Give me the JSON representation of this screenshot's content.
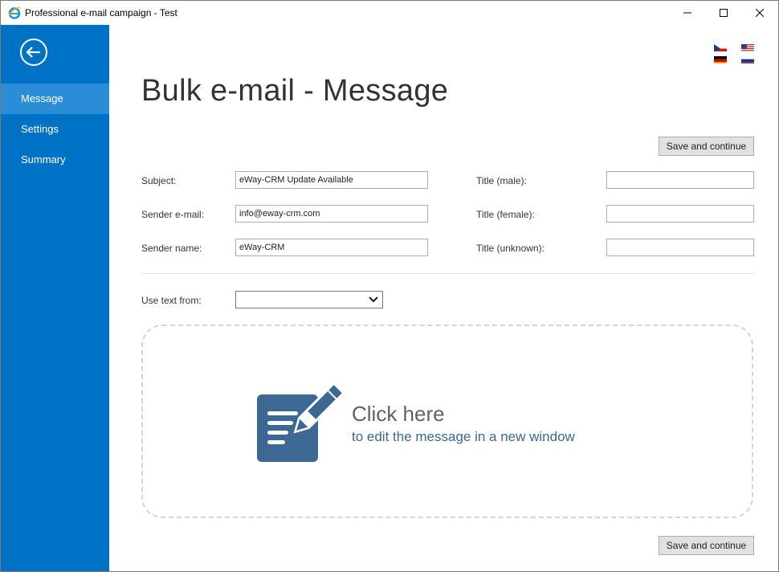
{
  "window": {
    "title": "Professional e-mail campaign - Test",
    "icons": [
      "app-icon",
      "minimize-icon",
      "maximize-icon",
      "close-icon"
    ]
  },
  "sidebar": {
    "back_icon": "back-arrow-icon",
    "items": [
      {
        "label": "Message",
        "active": true
      },
      {
        "label": "Settings",
        "active": false
      },
      {
        "label": "Summary",
        "active": false
      }
    ],
    "color": "#0072c6",
    "active_color": "#2b8dd8"
  },
  "languages": [
    "czech-flag-icon",
    "us-flag-icon",
    "german-flag-icon",
    "russian-flag-icon"
  ],
  "page": {
    "title": "Bulk e-mail - Message",
    "save_label": "Save and continue"
  },
  "form": {
    "subject_label": "Subject:",
    "subject_value": "eWay-CRM Update Available",
    "sender_email_label": "Sender e-mail:",
    "sender_email_value": "info@eway-crm.com",
    "sender_name_label": "Sender name:",
    "sender_name_value": "eWay-CRM",
    "title_male_label": "Title (male):",
    "title_male_value": "",
    "title_female_label": "Title (female):",
    "title_female_value": "",
    "title_unknown_label": "Title (unknown):",
    "title_unknown_value": "",
    "use_text_label": "Use text from:",
    "use_text_value": ""
  },
  "editor": {
    "title": "Click here",
    "subtitle": "to edit the message in a new window",
    "icon": "edit-message-icon"
  }
}
